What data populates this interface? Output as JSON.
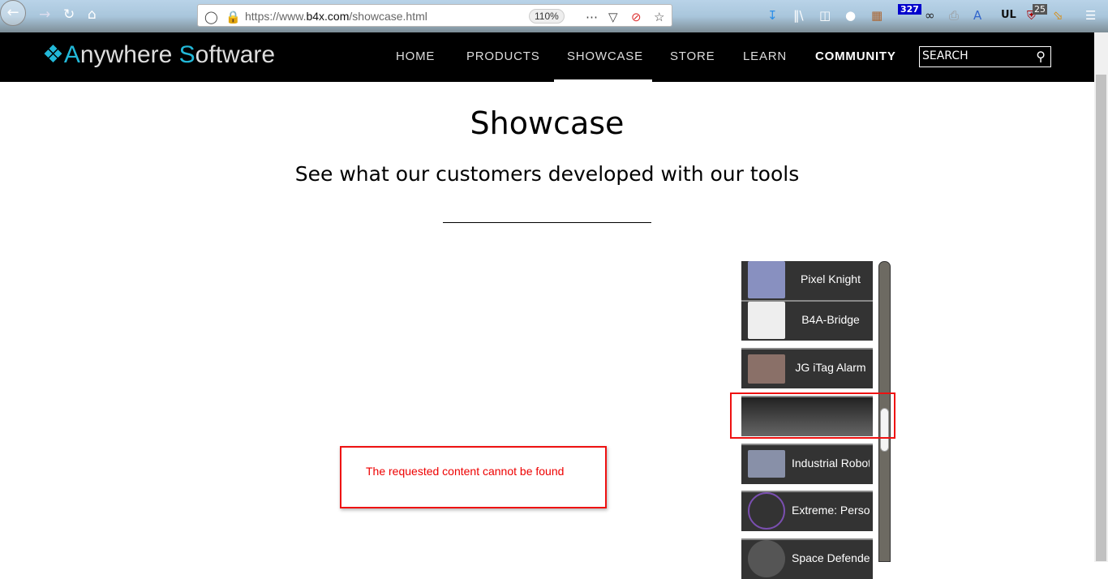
{
  "browser": {
    "url_prefix": "https://www.",
    "url_domain": "b4x.com",
    "url_path": "/showcase.html",
    "zoom": "110%",
    "badge_count": "327",
    "ublock_count": "25",
    "ul_label": "UL"
  },
  "nav": {
    "logo_a": "A",
    "logo_nywhere": "nywhere ",
    "logo_s": "S",
    "logo_oftware": "oftware",
    "items": [
      "HOME",
      "PRODUCTS",
      "SHOWCASE",
      "STORE",
      "LEARN",
      "COMMUNITY"
    ],
    "search_placeholder": "SEARCH"
  },
  "main": {
    "title": "Showcase",
    "subtitle": "See what our customers developed with our tools",
    "error": "The requested content cannot be found"
  },
  "showcase_list": [
    "Pixel Knight",
    "B4A-Bridge",
    "JG iTag Alarm",
    "",
    "Industrial Roboti",
    "Extreme: Persoi",
    "Space Defender"
  ]
}
